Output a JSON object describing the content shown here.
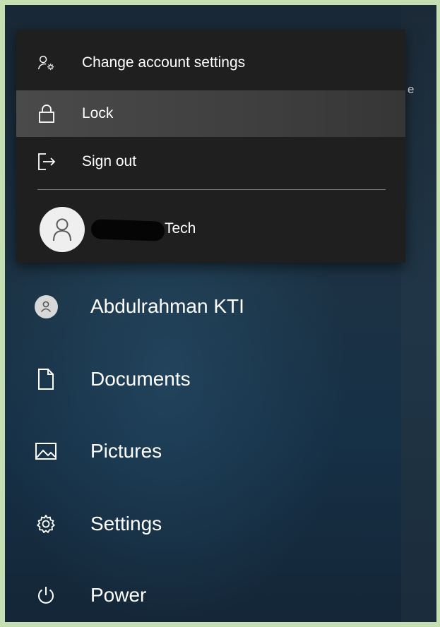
{
  "flyout": {
    "items": [
      {
        "label": "Change account settings",
        "icon": "account-settings-icon"
      },
      {
        "label": "Lock",
        "icon": "lock-icon",
        "highlighted": true
      },
      {
        "label": "Sign out",
        "icon": "sign-out-icon"
      }
    ],
    "account": {
      "name": "Tech",
      "icon": "person-icon"
    }
  },
  "start_menu": {
    "items": [
      {
        "label": "Abdulrahman KTI",
        "icon": "avatar-icon"
      },
      {
        "label": "Documents",
        "icon": "document-icon"
      },
      {
        "label": "Pictures",
        "icon": "pictures-icon"
      },
      {
        "label": "Settings",
        "icon": "gear-icon"
      },
      {
        "label": "Power",
        "icon": "power-icon"
      }
    ]
  },
  "background": {
    "cut_off_text": "e"
  },
  "colors": {
    "outer_border": "#c6dfb2",
    "flyout_bg": "#1f1f1f",
    "highlight": "#4a4a4a",
    "text": "#ffffff"
  }
}
